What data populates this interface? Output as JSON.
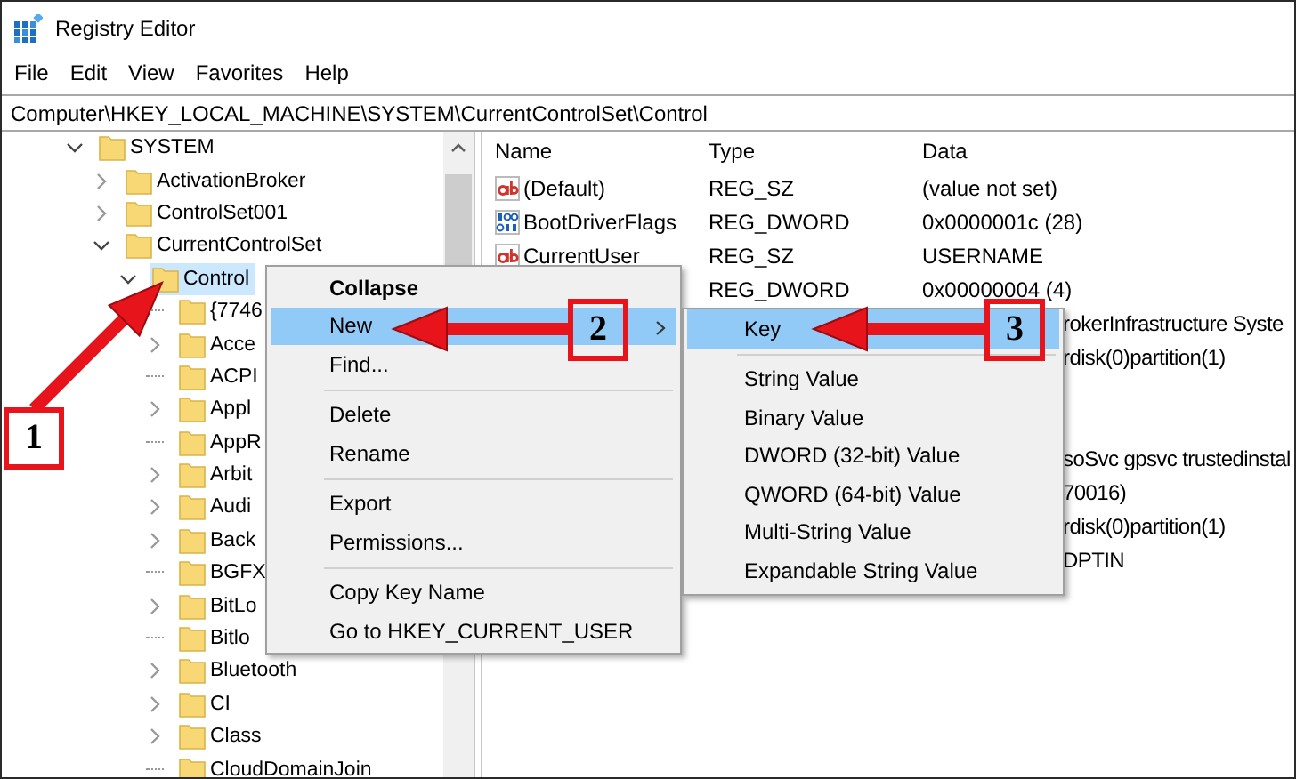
{
  "window": {
    "title": "Registry Editor"
  },
  "menu_bar": [
    "File",
    "Edit",
    "View",
    "Favorites",
    "Help"
  ],
  "address_bar": {
    "value": "Computer\\HKEY_LOCAL_MACHINE\\SYSTEM\\CurrentControlSet\\Control"
  },
  "tree": [
    {
      "label": "SYSTEM",
      "kind": "branch",
      "expanded": true,
      "selected": false,
      "children": [
        {
          "label": "ActivationBroker",
          "kind": "branch",
          "expanded": false,
          "selected": false
        },
        {
          "label": "ControlSet001",
          "kind": "branch",
          "expanded": false,
          "selected": false
        },
        {
          "label": "CurrentControlSet",
          "kind": "branch",
          "expanded": true,
          "selected": false,
          "children": [
            {
              "label": "Control",
              "kind": "branch",
              "expanded": true,
              "selected": true,
              "children": [
                {
                  "label": "{7746",
                  "kind": "leaf",
                  "selected": false
                },
                {
                  "label": "Acce",
                  "kind": "branch",
                  "expanded": false,
                  "selected": false
                },
                {
                  "label": "ACPI",
                  "kind": "leaf",
                  "selected": false
                },
                {
                  "label": "Appl",
                  "kind": "branch",
                  "expanded": false,
                  "selected": false
                },
                {
                  "label": "AppR",
                  "kind": "leaf",
                  "selected": false
                },
                {
                  "label": "Arbit",
                  "kind": "branch",
                  "expanded": false,
                  "selected": false
                },
                {
                  "label": "Audi",
                  "kind": "branch",
                  "expanded": false,
                  "selected": false
                },
                {
                  "label": "Back",
                  "kind": "branch",
                  "expanded": false,
                  "selected": false
                },
                {
                  "label": "BGFX",
                  "kind": "leaf",
                  "selected": false
                },
                {
                  "label": "BitLo",
                  "kind": "branch",
                  "expanded": false,
                  "selected": false
                },
                {
                  "label": "Bitlo",
                  "kind": "leaf",
                  "selected": false
                },
                {
                  "label": "Bluetooth",
                  "kind": "branch",
                  "expanded": false,
                  "selected": false
                },
                {
                  "label": "CI",
                  "kind": "branch",
                  "expanded": false,
                  "selected": false
                },
                {
                  "label": "Class",
                  "kind": "branch",
                  "expanded": false,
                  "selected": false
                },
                {
                  "label": "CloudDomainJoin",
                  "kind": "leaf",
                  "selected": false
                }
              ]
            }
          ]
        }
      ]
    }
  ],
  "values": {
    "columns": [
      "Name",
      "Type",
      "Data"
    ],
    "rows": [
      {
        "kind": "string",
        "name": "(Default)",
        "type": "REG_SZ",
        "data": "(value not set)",
        "clipped": false
      },
      {
        "kind": "binary",
        "name": "BootDriverFlags",
        "type": "REG_DWORD",
        "data": "0x0000001c (28)",
        "clipped": false
      },
      {
        "kind": "string",
        "name": "CurrentUser",
        "type": "REG_SZ",
        "data": "USERNAME",
        "clipped": false
      },
      {
        "type": "REG_DWORD",
        "data": "0x00000004 (4)",
        "clipped": false
      },
      {
        "data": "rokerInfrastructure Syste",
        "clipped": true
      },
      {
        "data": "rdisk(0)partition(1)",
        "clipped": true
      },
      {
        "data": "soSvc gpsvc trustedinstal",
        "clipped": true
      },
      {
        "data": "70016)",
        "clipped": true
      },
      {
        "data": "rdisk(0)partition(1)",
        "clipped": true
      },
      {
        "data": "DPTIN",
        "clipped": true
      }
    ]
  },
  "context_menu": {
    "items": [
      {
        "kind": "item",
        "label": "Collapse",
        "bold": true,
        "selected": false,
        "submenu": false
      },
      {
        "kind": "item",
        "label": "New",
        "bold": false,
        "selected": true,
        "submenu": true
      },
      {
        "kind": "item",
        "label": "Find...",
        "bold": false,
        "selected": false,
        "submenu": false
      },
      {
        "kind": "separator"
      },
      {
        "kind": "item",
        "label": "Delete",
        "bold": false,
        "selected": false,
        "submenu": false
      },
      {
        "kind": "item",
        "label": "Rename",
        "bold": false,
        "selected": false,
        "submenu": false
      },
      {
        "kind": "separator"
      },
      {
        "kind": "item",
        "label": "Export",
        "bold": false,
        "selected": false,
        "submenu": false
      },
      {
        "kind": "item",
        "label": "Permissions...",
        "bold": false,
        "selected": false,
        "submenu": false
      },
      {
        "kind": "separator"
      },
      {
        "kind": "item",
        "label": "Copy Key Name",
        "bold": false,
        "selected": false,
        "submenu": false
      },
      {
        "kind": "item",
        "label": "Go to HKEY_CURRENT_USER",
        "bold": false,
        "selected": false,
        "submenu": false
      }
    ]
  },
  "submenu": {
    "items": [
      {
        "kind": "item",
        "label": "Key",
        "selected": true
      },
      {
        "kind": "separator"
      },
      {
        "kind": "item",
        "label": "String Value",
        "selected": false
      },
      {
        "kind": "item",
        "label": "Binary Value",
        "selected": false
      },
      {
        "kind": "item",
        "label": "DWORD (32-bit) Value",
        "selected": false
      },
      {
        "kind": "item",
        "label": "QWORD (64-bit) Value",
        "selected": false
      },
      {
        "kind": "item",
        "label": "Multi-String Value",
        "selected": false
      },
      {
        "kind": "item",
        "label": "Expandable String Value",
        "selected": false
      }
    ]
  },
  "annotations": [
    {
      "label": "1"
    },
    {
      "label": "2"
    },
    {
      "label": "3"
    }
  ]
}
